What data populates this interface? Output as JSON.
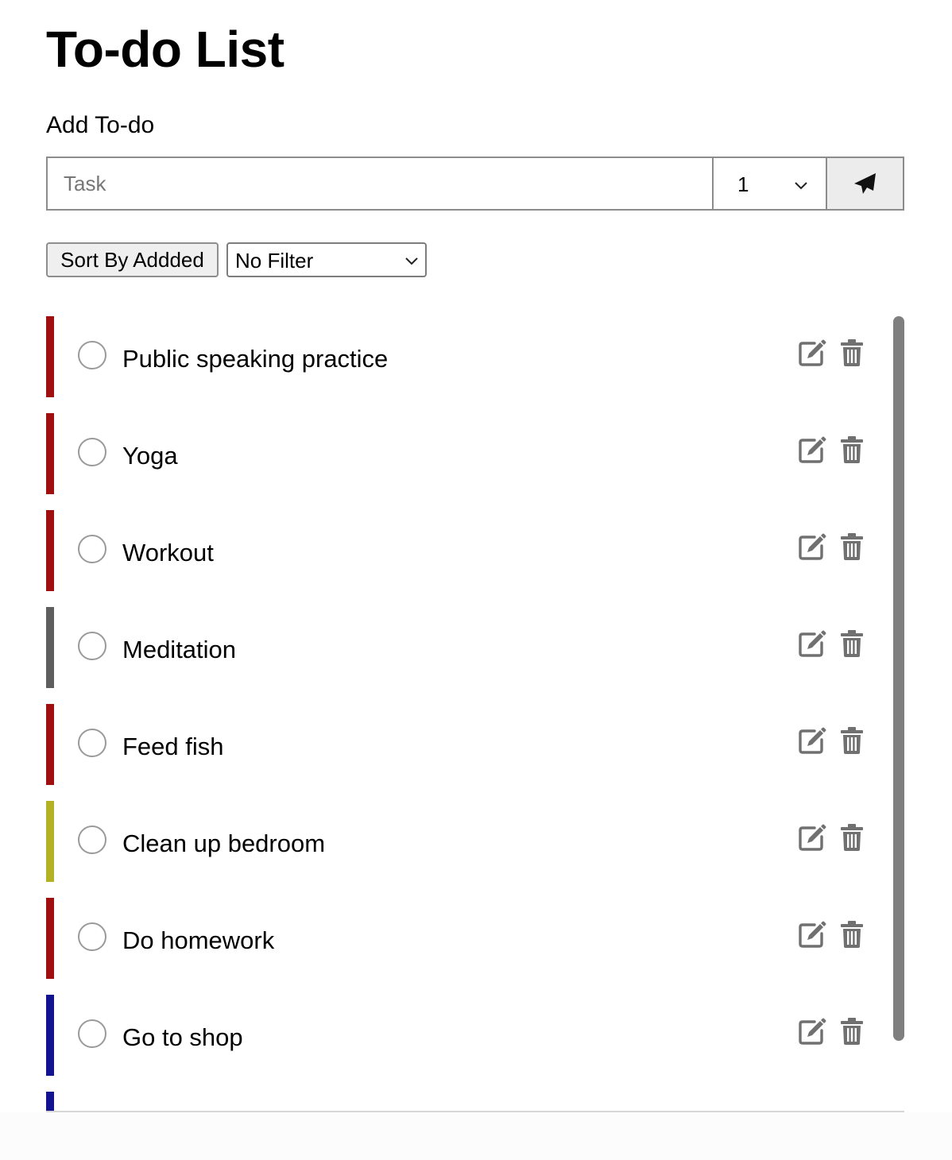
{
  "title": "To-do List",
  "add_section": {
    "label": "Add To-do",
    "task_placeholder": "Task",
    "priority_value": "1",
    "submit_icon": "paper-plane-icon"
  },
  "controls": {
    "sort_label": "Sort By Addded",
    "filter_value": "No Filter"
  },
  "todos": [
    {
      "text": "Public speaking practice",
      "color": "#a00f0f"
    },
    {
      "text": "Yoga",
      "color": "#a00f0f"
    },
    {
      "text": "Workout",
      "color": "#a00f0f"
    },
    {
      "text": "Meditation",
      "color": "#5e5e5e"
    },
    {
      "text": "Feed fish",
      "color": "#a00f0f"
    },
    {
      "text": "Clean up bedroom",
      "color": "#b3b224"
    },
    {
      "text": "Do homework",
      "color": "#a00f0f"
    },
    {
      "text": "Go to shop",
      "color": "#13138f"
    },
    {
      "text": "",
      "color": "#13138f"
    }
  ],
  "icons": {
    "edit": "edit-icon",
    "delete": "trash-icon",
    "check": "circle-checkbox-icon"
  },
  "colors": {
    "icon_gray": "#707070",
    "scrollbar": "#7f7f7f"
  }
}
